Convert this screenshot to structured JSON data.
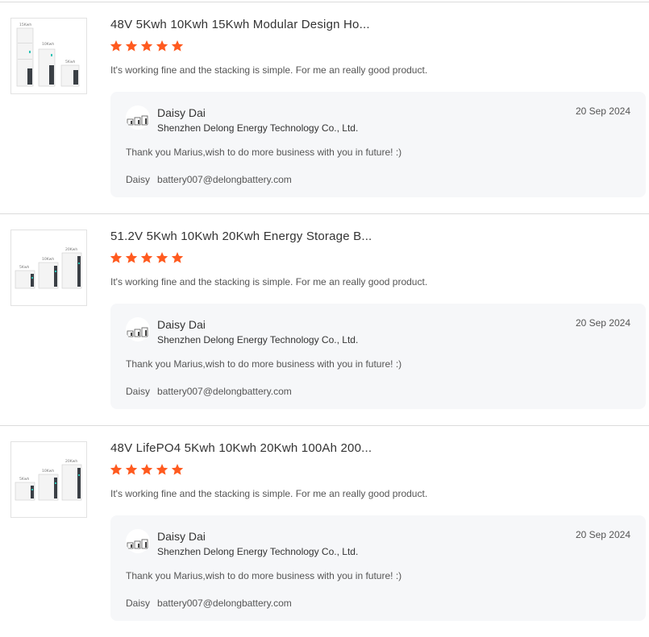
{
  "colors": {
    "star": "#ff5a1f",
    "reply_bg": "#f6f7f9",
    "divider": "#dcdcdc"
  },
  "reviews": [
    {
      "product_title": "48V 5Kwh 10Kwh 15Kwh Modular Design Ho...",
      "rating": 5,
      "comment": "It's working fine and the stacking is simple. For me an really good product.",
      "thumbnail_labels": [
        "15Kwh",
        "10Kwh",
        "5Kwh"
      ],
      "reply": {
        "name": "Daisy Dai",
        "company": "Shenzhen Delong Energy Technology Co., Ltd.",
        "date": "20 Sep 2024",
        "message": "Thank you Marius,wish to do more business with you in future! :)",
        "signature_name": "Daisy",
        "signature_email": "battery007@delongbattery.com"
      }
    },
    {
      "product_title": "51.2V 5Kwh 10Kwh 20Kwh Energy Storage B...",
      "rating": 5,
      "comment": "It's working fine and the stacking is simple. For me an really good product.",
      "thumbnail_labels": [
        "20Kwh",
        "10Kwh",
        "5Kwh"
      ],
      "reply": {
        "name": "Daisy Dai",
        "company": "Shenzhen Delong Energy Technology Co., Ltd.",
        "date": "20 Sep 2024",
        "message": "Thank you Marius,wish to do more business with you in future! :)",
        "signature_name": "Daisy",
        "signature_email": "battery007@delongbattery.com"
      }
    },
    {
      "product_title": "48V LifePO4 5Kwh 10Kwh 20Kwh 100Ah 200...",
      "rating": 5,
      "comment": "It's working fine and the stacking is simple. For me an really good product.",
      "thumbnail_labels": [
        "20Kwh",
        "10Kwh",
        "5Kwh"
      ],
      "reply": {
        "name": "Daisy Dai",
        "company": "Shenzhen Delong Energy Technology Co., Ltd.",
        "date": "20 Sep 2024",
        "message": "Thank you Marius,wish to do more business with you in future! :)",
        "signature_name": "Daisy",
        "signature_email": "battery007@delongbattery.com"
      }
    }
  ]
}
